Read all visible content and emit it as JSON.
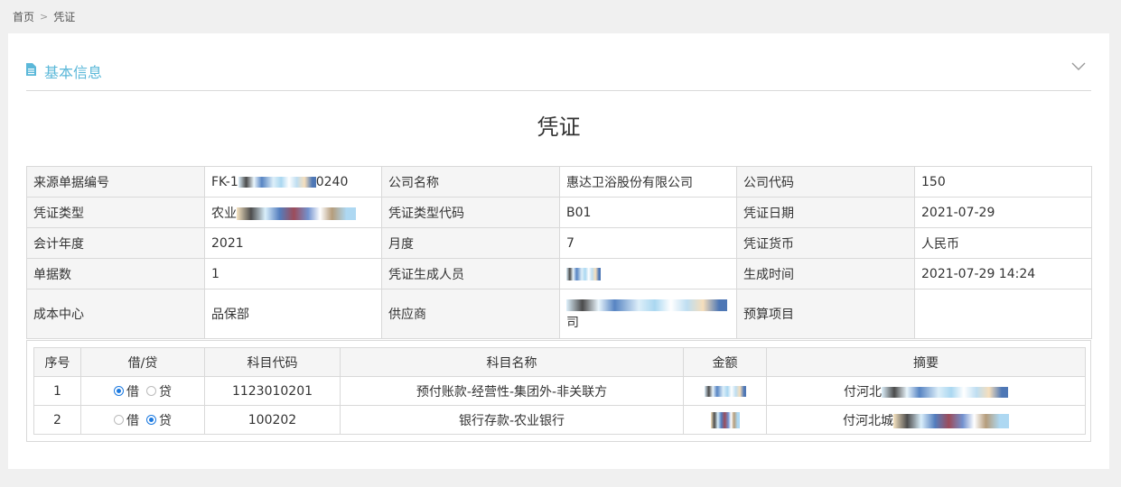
{
  "breadcrumb": {
    "home": "首页",
    "separator": ">",
    "current": "凭证"
  },
  "section": {
    "title": "基本信息",
    "icon": "document-icon",
    "toggle_icon": "chevron-down-icon"
  },
  "voucher_title": "凭证",
  "info": {
    "source_no_label": "来源单据编号",
    "source_no_value_prefix": "FK-1",
    "source_no_value_suffix": "0240",
    "company_name_label": "公司名称",
    "company_name_value": "惠达卫浴股份有限公司",
    "company_code_label": "公司代码",
    "company_code_value": "150",
    "voucher_type_label": "凭证类型",
    "voucher_type_value_prefix": "农业",
    "voucher_type_code_label": "凭证类型代码",
    "voucher_type_code_value": "B01",
    "voucher_date_label": "凭证日期",
    "voucher_date_value": "2021-07-29",
    "fiscal_year_label": "会计年度",
    "fiscal_year_value": "2021",
    "month_label": "月度",
    "month_value": "7",
    "currency_label": "凭证货币",
    "currency_value": "人民币",
    "doc_count_label": "单据数",
    "doc_count_value": "1",
    "creator_label": "凭证生成人员",
    "created_time_label": "生成时间",
    "created_time_value": "2021-07-29 14:24",
    "cost_center_label": "成本中心",
    "cost_center_value": "品保部",
    "supplier_label": "供应商",
    "supplier_value_suffix": "司",
    "budget_label": "预算项目",
    "budget_value": ""
  },
  "detail": {
    "headers": [
      "序号",
      "借/贷",
      "科目代码",
      "科目名称",
      "金额",
      "摘要"
    ],
    "debit_label": "借",
    "credit_label": "贷",
    "rows": [
      {
        "no": "1",
        "debit_checked": true,
        "code": "1123010201",
        "name": "预付账款-经营性-集团外-非关联方",
        "summary_prefix": "付河北"
      },
      {
        "no": "2",
        "debit_checked": false,
        "code": "100202",
        "name": "银行存款-农业银行",
        "summary_prefix": "付河北城"
      }
    ]
  }
}
